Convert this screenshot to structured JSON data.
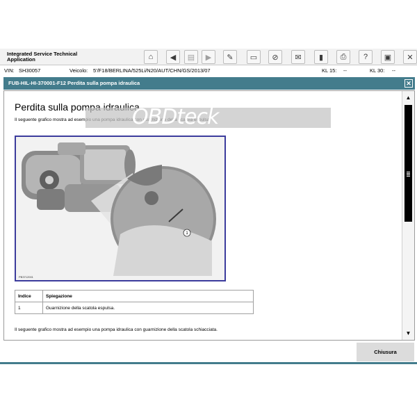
{
  "app": {
    "title": "Integrated Service Technical Application"
  },
  "toolbar": {
    "icons": [
      "home-icon",
      "back-icon",
      "document-icon",
      "forward-icon",
      "wrench-icon",
      "vehicle-info-icon",
      "measure-icon",
      "mail-icon",
      "battery-icon",
      "print-icon",
      "help-icon",
      "save-icon",
      "close-icon"
    ]
  },
  "vehicle": {
    "vin_label": "VIN:",
    "vin": "SH30057",
    "veicolo_label": "Veicolo:",
    "veicolo": "5'/F18/BERLINA/525Li/N20/AUT/CHN/GS/2013/07",
    "kl15_label": "KL 15:",
    "kl15": "--",
    "kl30_label": "KL 30:",
    "kl30": "--"
  },
  "window": {
    "title": "FUB-HIL-HI-370001-F12 Perdita sulla pompa idraulica"
  },
  "document": {
    "heading": "Perdita sulla pompa idraulica",
    "intro": "Il seguente grafico mostra ad esempio una pompa idraulica con guarnizione della scatola espulsa.",
    "figure_id": "PB3712001",
    "callout_number": "1",
    "watermark": "OBDteck",
    "table_headers": [
      "Indice",
      "Spiegazione"
    ],
    "table_rows": [
      [
        "1",
        "Guarnizione della scatola espulsa."
      ]
    ],
    "footer_text": "Il seguente grafico mostra ad esempio una pompa idraulica con guarnizione della scatola schiacciata."
  },
  "buttons": {
    "close": "Chiusura"
  },
  "colors": {
    "accent": "#437c8c",
    "figure_border": "#3b3b9c"
  }
}
